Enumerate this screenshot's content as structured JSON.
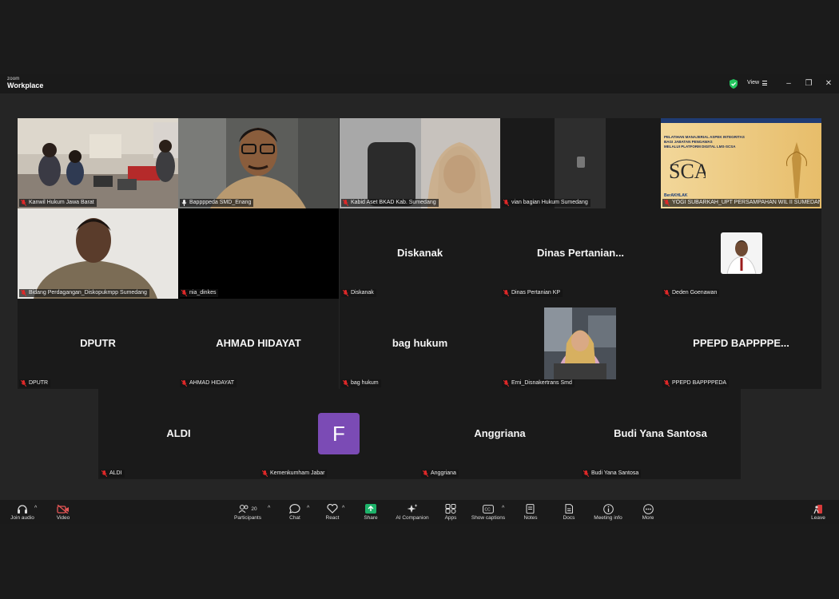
{
  "app": {
    "logo_top": "zoom",
    "logo_bottom": "Workplace",
    "view_label": "View"
  },
  "tiles": [
    {
      "label": "Kanwil Hukum Jawa Barat",
      "display": ""
    },
    {
      "label": "Bappppeda SMD_Enang",
      "display": ""
    },
    {
      "label": "Kabid Aset BKAD Kab. Sumedang",
      "display": ""
    },
    {
      "label": "vian bagian Hukum Sumedang",
      "display": ""
    },
    {
      "label": "YOGI SUBARKAH_UPT PERSAMPAHAN WIL II SUMEDANG...",
      "display": ""
    },
    {
      "label": "Bidang Perdagangan_Diskopukmpp Sumedang",
      "display": ""
    },
    {
      "label": "nia_dinkes",
      "display": ""
    },
    {
      "label": "Diskanak",
      "display": "Diskanak"
    },
    {
      "label": "Dinas Pertanian KP",
      "display": "Dinas  Pertanian..."
    },
    {
      "label": "Deden Goenawan",
      "display": ""
    },
    {
      "label": "DPUTR",
      "display": "DPUTR"
    },
    {
      "label": "AHMAD HIDAYAT",
      "display": "AHMAD HIDAYAT"
    },
    {
      "label": "bag hukum",
      "display": "bag hukum"
    },
    {
      "label": "Erni_Disnakertrans Smd",
      "display": ""
    },
    {
      "label": "PPEPD BAPPPPEDA",
      "display": "PPEPD  BAPPPPE..."
    },
    {
      "label": "ALDI",
      "display": "ALDI"
    },
    {
      "label": "Kemenkumham Jabar",
      "display": "",
      "avatar": "F"
    },
    {
      "label": "Anggriana",
      "display": "Anggriana"
    },
    {
      "label": "Budi Yana Santosa",
      "display": "Budi Yana Santosa"
    }
  ],
  "banner": {
    "line1": "PELATIHAN MANAJERIAL ASPEK INTEGRITAS",
    "line2": "BAGI JABATAN PENGAWAS",
    "line3": "MELALUI PLATFORM DIGITAL LMS-SCSA",
    "brand": "BerAKHLAK"
  },
  "toolbar": {
    "join_audio": "Join audio",
    "video": "Video",
    "participants": "Participants",
    "participants_count": "20",
    "chat": "Chat",
    "react": "React",
    "share": "Share",
    "ai_companion": "AI Companion",
    "apps": "Apps",
    "show_captions": "Show captions",
    "notes": "Notes",
    "docs": "Docs",
    "meeting_info": "Meeting info",
    "more": "More",
    "leave": "Leave"
  },
  "colors": {
    "active_speaker": "#25d366",
    "muted": "#e02828",
    "share": "#1db36a",
    "avatar": "#7b4bb5",
    "leave": "#d93a3a"
  }
}
